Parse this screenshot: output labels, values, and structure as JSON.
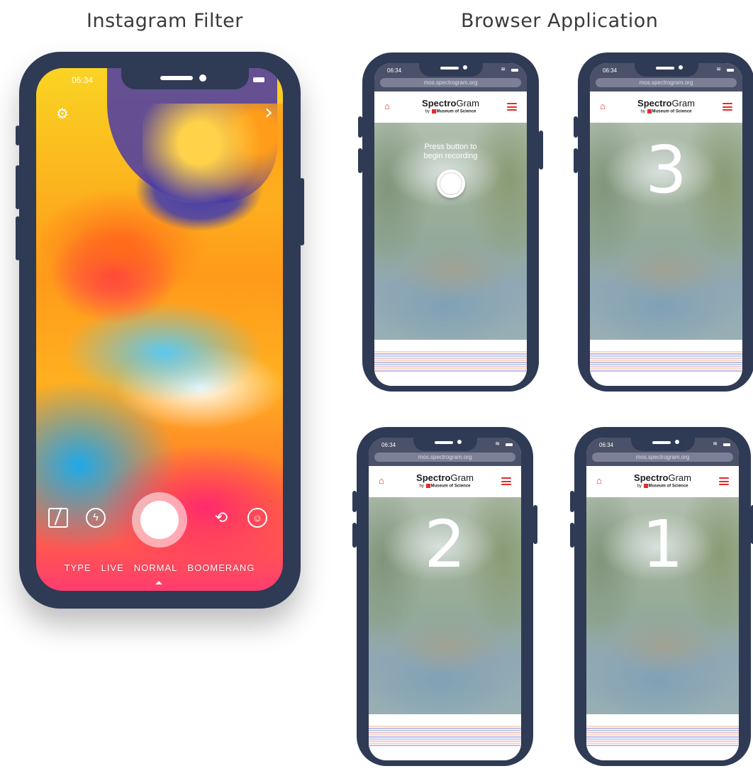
{
  "titles": {
    "left": "Instagram Filter",
    "right": "Browser Application"
  },
  "instagram": {
    "time": "06:34",
    "modes": [
      "TYPE",
      "LIVE",
      "NORMAL",
      "BOOMERANG"
    ],
    "icons": {
      "settings": "gear-icon",
      "next": "chevron-right-icon",
      "type": "type-icon",
      "flash": "flash-icon",
      "switch_camera": "switch-camera-icon",
      "face_filter": "face-filter-icon"
    }
  },
  "browser": {
    "time": "06:34",
    "url": "mos.spectrogram.org",
    "logo_bold": "Spectro",
    "logo_light": "Gram",
    "logo_sub_by": "by",
    "logo_sub_org": "Museum of Science",
    "press_text_line1": "Press button to",
    "press_text_line2": "begin recording",
    "countdown": [
      "3",
      "2",
      "1"
    ],
    "colors": {
      "accent": "#e32b2b",
      "phone_body": "#2f3a55"
    }
  }
}
